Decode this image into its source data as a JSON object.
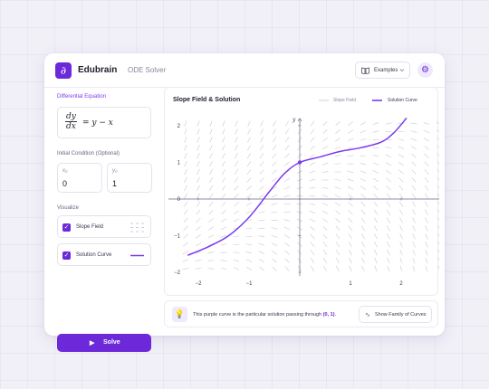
{
  "header": {
    "logo_glyph": "∂",
    "brand": "Edubrain",
    "subtitle": "ODE Solver",
    "examples_label": "Examples",
    "settings_icon": "gear-icon"
  },
  "left_panel": {
    "de_label": "Differential Equation",
    "equation": {
      "num": "dy",
      "den": "dx",
      "rhs": "= y − x"
    },
    "ic_label": "Initial Condition (Optional)",
    "x0": {
      "sub": "x₀",
      "value": "0"
    },
    "y0": {
      "sub": "y₀",
      "value": "1"
    },
    "visualize_label": "Visualize",
    "slope_field": {
      "label": "Slope Field",
      "checked": true
    },
    "solution_curve": {
      "label": "Solution Curve",
      "checked": true
    },
    "solve_label": "Solve"
  },
  "plot": {
    "title": "Slope Field & Solution",
    "legend_slope": "Slope Field",
    "legend_solution": "Solution Curve"
  },
  "chart_data": {
    "type": "line",
    "equation": "dy/dx = y - x",
    "xlabel": "x",
    "ylabel": "y",
    "xlim": [
      -2.5,
      3.5
    ],
    "ylim": [
      -2.2,
      2.3
    ],
    "xticks": [
      -2,
      -1,
      0,
      1,
      2
    ],
    "yticks": [
      -2,
      -1,
      0,
      1,
      2
    ],
    "grid": false,
    "legend_position": "top-right",
    "initial_point": {
      "x": 0,
      "y": 1
    },
    "series": [
      {
        "name": "Solution Curve",
        "color": "#7c3aed",
        "points": [
          [
            -2.2,
            -1.53
          ],
          [
            -1.8,
            -1.3
          ],
          [
            -1.4,
            -1.0
          ],
          [
            -1.0,
            -0.5
          ],
          [
            -0.6,
            0.2
          ],
          [
            -0.3,
            0.7
          ],
          [
            0,
            1.0
          ],
          [
            0.4,
            1.15
          ],
          [
            0.8,
            1.3
          ],
          [
            1.2,
            1.4
          ],
          [
            1.6,
            1.55
          ],
          [
            1.85,
            1.8
          ],
          [
            2.1,
            2.2
          ]
        ]
      }
    ]
  },
  "footer": {
    "tip_text": "This purple curve is the particular solution passing through ",
    "tip_point": "(0, 1)",
    "tip_end": ".",
    "family_label": "Show Family of Curves"
  },
  "colors": {
    "accent": "#6d28d9",
    "accent_light": "#efe9fd",
    "slope": "#c9c7d3"
  }
}
